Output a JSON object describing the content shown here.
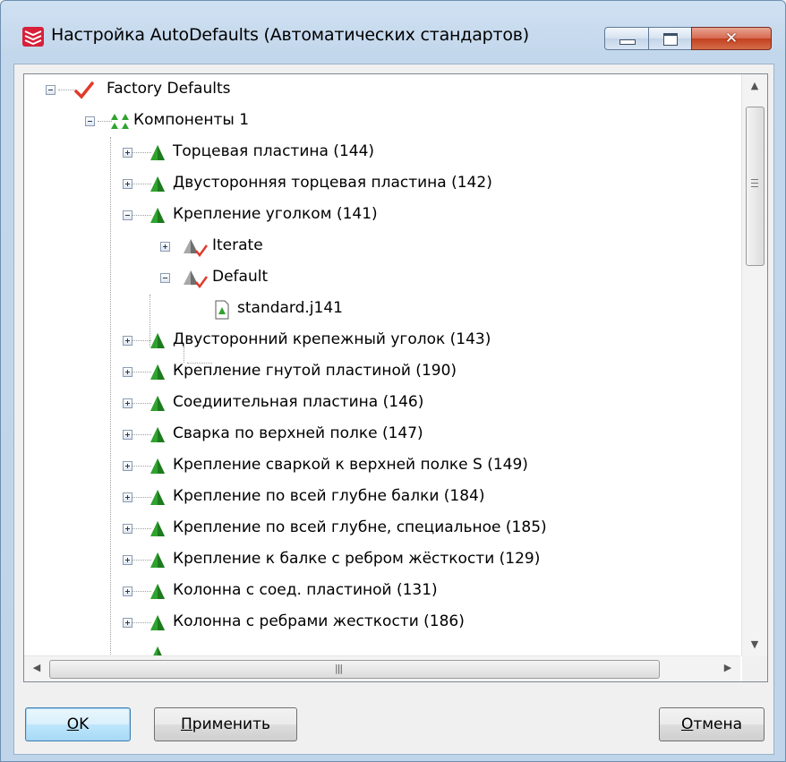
{
  "window": {
    "title": "Настройка AutoDefaults (Автоматических стандартов)",
    "app_icon": "tekla-icon",
    "close_glyph": "✕"
  },
  "tree": {
    "root": {
      "label": "Factory Defaults",
      "icon": "checkmark-icon"
    },
    "group": {
      "label": "Компоненты 1",
      "icon": "components-icon"
    },
    "items": [
      {
        "label": "Торцевая пластина (144)"
      },
      {
        "label": "Двусторонняя торцевая пластина (142)"
      },
      {
        "label": "Крепление уголком (141)"
      },
      {
        "label": "Двусторонний крепежный уголок (143)"
      },
      {
        "label": "Крепление гнутой пластиной (190)"
      },
      {
        "label": "Соедиительная пластина (146)"
      },
      {
        "label": "Сварка по верхней полке (147)"
      },
      {
        "label": "Крепление сваркой к верхней полке S (149)"
      },
      {
        "label": "Крепление по всей глубне балки (184)"
      },
      {
        "label": "Крепление по всей глубне, специальное (185)"
      },
      {
        "label": "Крепление к балке с ребром жёсткости (129)"
      },
      {
        "label": "Колонна с соед. пластиной (131)"
      },
      {
        "label": "Колонна с ребрами жесткости (186)"
      }
    ],
    "sub_items": [
      {
        "label": "Iterate"
      },
      {
        "label": "Default"
      }
    ],
    "file": {
      "label": "standard.j141",
      "icon": "file-icon"
    }
  },
  "buttons": {
    "ok_mnemonic": "O",
    "ok_rest": "K",
    "apply_mnemonic": "П",
    "apply_rest": "рименить",
    "cancel_mnemonic": "О",
    "cancel_rest": "тмена"
  },
  "colors": {
    "accent": "#3c7fb1",
    "check": "#e03a2a",
    "cone": "#2fa32f"
  }
}
